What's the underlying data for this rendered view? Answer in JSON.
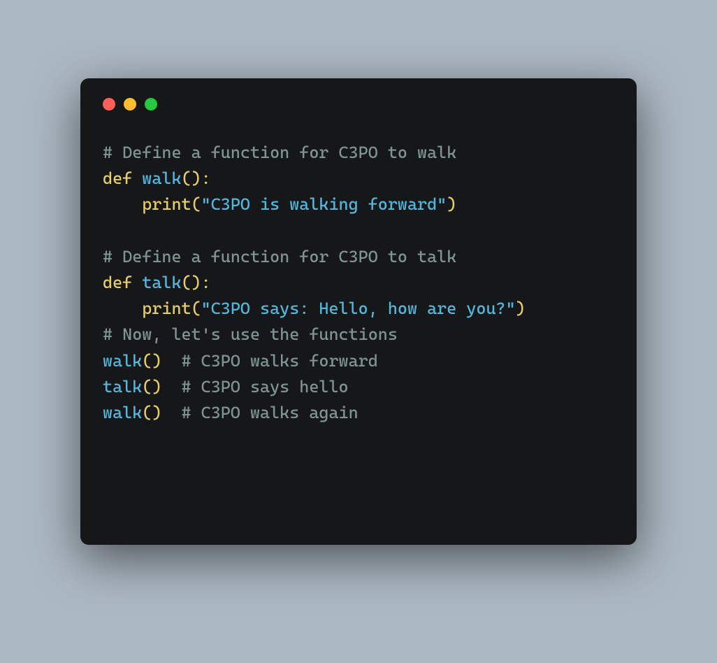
{
  "colors": {
    "background": "#acb8c3",
    "window": "#151718",
    "trafficRed": "#ff5f56",
    "trafficYellow": "#ffbd2e",
    "trafficGreen": "#27c93f",
    "comment": "#809393",
    "keyword": "#e6cd69",
    "func": "#55b5db",
    "string": "#55b5db",
    "default": "#a7d1e2"
  },
  "code": {
    "tokens": [
      [
        {
          "t": "comment",
          "v": "# Define a function for C3PO to walk"
        }
      ],
      [
        {
          "t": "keyword",
          "v": "def"
        },
        {
          "t": "default",
          "v": " "
        },
        {
          "t": "func",
          "v": "walk"
        },
        {
          "t": "paren",
          "v": "():"
        }
      ],
      [
        {
          "t": "default",
          "v": "    "
        },
        {
          "t": "keyword",
          "v": "print"
        },
        {
          "t": "paren",
          "v": "("
        },
        {
          "t": "string",
          "v": "\"C3PO is walking forward\""
        },
        {
          "t": "paren",
          "v": ")"
        }
      ],
      [],
      [
        {
          "t": "comment",
          "v": "# Define a function for C3PO to talk"
        }
      ],
      [
        {
          "t": "keyword",
          "v": "def"
        },
        {
          "t": "default",
          "v": " "
        },
        {
          "t": "func",
          "v": "talk"
        },
        {
          "t": "paren",
          "v": "():"
        }
      ],
      [
        {
          "t": "default",
          "v": "    "
        },
        {
          "t": "keyword",
          "v": "print"
        },
        {
          "t": "paren",
          "v": "("
        },
        {
          "t": "string",
          "v": "\"C3PO says: Hello, how are you?\""
        },
        {
          "t": "paren",
          "v": ")"
        }
      ],
      [
        {
          "t": "comment",
          "v": "# Now, let's use the functions"
        }
      ],
      [
        {
          "t": "func",
          "v": "walk"
        },
        {
          "t": "paren",
          "v": "()"
        },
        {
          "t": "default",
          "v": "  "
        },
        {
          "t": "comment",
          "v": "# C3PO walks forward"
        }
      ],
      [
        {
          "t": "func",
          "v": "talk"
        },
        {
          "t": "paren",
          "v": "()"
        },
        {
          "t": "default",
          "v": "  "
        },
        {
          "t": "comment",
          "v": "# C3PO says hello"
        }
      ],
      [
        {
          "t": "func",
          "v": "walk"
        },
        {
          "t": "paren",
          "v": "()"
        },
        {
          "t": "default",
          "v": "  "
        },
        {
          "t": "comment",
          "v": "# C3PO walks again"
        }
      ]
    ]
  }
}
